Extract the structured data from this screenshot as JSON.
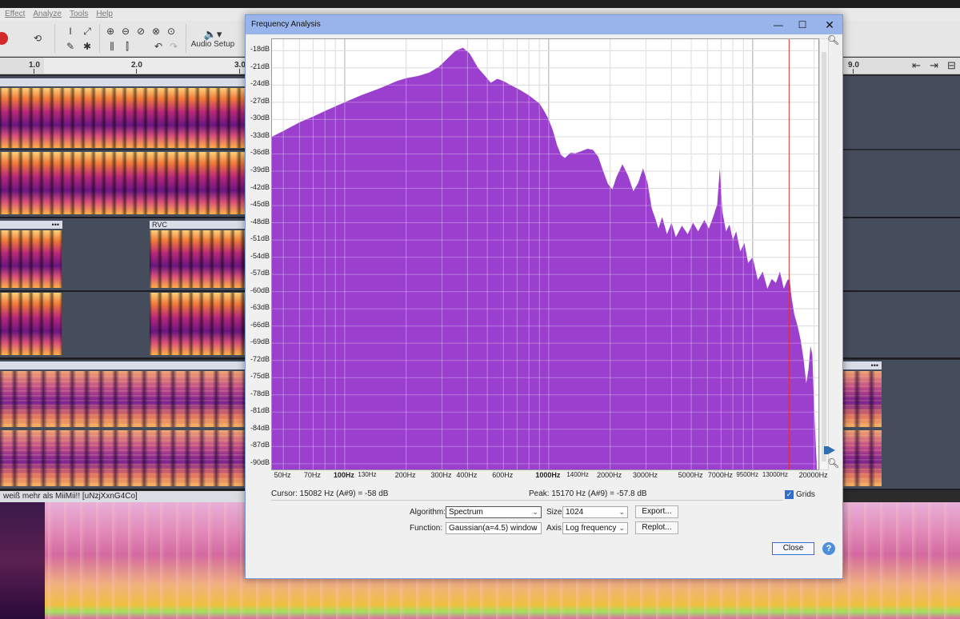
{
  "menu": [
    "Effect",
    "Analyze",
    "Tools",
    "Help"
  ],
  "toolbar": {
    "audio_setup_label": "Audio Setup"
  },
  "ruler": {
    "ticks": [
      "1.0",
      "2.0",
      "3.0",
      "9.0"
    ]
  },
  "clips": {
    "rvc_label": "RVC",
    "menu_dots": "•••",
    "track_name": "weiß mehr als MiiMii!! [uNzjXxnG4Co]"
  },
  "dialog": {
    "title": "Frequency Analysis",
    "cursor_text": "Cursor:  15082 Hz (A#9) = -58 dB",
    "peak_text": "Peak:  15170 Hz (A#9) = -57.8 dB",
    "grids_label": "Grids",
    "grids_checked": true,
    "algorithm_label": "Algorithm:",
    "algorithm_value": "Spectrum",
    "size_label": "Size:",
    "size_value": "1024",
    "function_label": "Function:",
    "function_value": "Gaussian(a=4.5) window",
    "axis_label": "Axis:",
    "axis_value": "Log frequency",
    "export_label": "Export...",
    "replot_label": "Replot...",
    "close_label": "Close",
    "help_label": "?"
  },
  "chart_data": {
    "type": "area",
    "x_scale": "log",
    "y_unit": "dB",
    "fill_color": "#9b3fcf",
    "cursor_line_color": "#e03030",
    "cursor_frequency_hz": 15082,
    "grid": true,
    "xlim": [
      44,
      21000
    ],
    "ylim": [
      -91,
      -16
    ],
    "y_ticks": [
      "-18dB",
      "-21dB",
      "-24dB",
      "-27dB",
      "-30dB",
      "-33dB",
      "-36dB",
      "-39dB",
      "-42dB",
      "-45dB",
      "-48dB",
      "-51dB",
      "-54dB",
      "-57dB",
      "-60dB",
      "-63dB",
      "-66dB",
      "-69dB",
      "-72dB",
      "-75dB",
      "-78dB",
      "-81dB",
      "-84dB",
      "-87dB",
      "-90dB"
    ],
    "x_ticks": [
      {
        "hz": 50,
        "label": "50Hz"
      },
      {
        "hz": 70,
        "label": "70Hz"
      },
      {
        "hz": 100,
        "label": "100Hz",
        "bold": true
      },
      {
        "hz": 130,
        "label": "130Hz",
        "small": true
      },
      {
        "hz": 200,
        "label": "200Hz"
      },
      {
        "hz": 300,
        "label": "300Hz"
      },
      {
        "hz": 400,
        "label": "400Hz"
      },
      {
        "hz": 600,
        "label": "600Hz"
      },
      {
        "hz": 1000,
        "label": "1000Hz",
        "bold": true
      },
      {
        "hz": 1400,
        "label": "1400Hz",
        "small": true
      },
      {
        "hz": 2000,
        "label": "2000Hz"
      },
      {
        "hz": 3000,
        "label": "3000Hz"
      },
      {
        "hz": 5000,
        "label": "5000Hz"
      },
      {
        "hz": 7000,
        "label": "7000Hz"
      },
      {
        "hz": 9500,
        "label": "9500Hz",
        "small": true
      },
      {
        "hz": 13000,
        "label": "13000Hz",
        "small": true
      },
      {
        "hz": 20000,
        "label": "20000Hz"
      }
    ],
    "spectrum": [
      [
        44,
        -33
      ],
      [
        50,
        -32
      ],
      [
        60,
        -30.5
      ],
      [
        70,
        -29.5
      ],
      [
        80,
        -28.5
      ],
      [
        100,
        -27
      ],
      [
        120,
        -25.8
      ],
      [
        150,
        -24.5
      ],
      [
        180,
        -23.3
      ],
      [
        200,
        -22.8
      ],
      [
        230,
        -22.4
      ],
      [
        260,
        -21.8
      ],
      [
        290,
        -20.8
      ],
      [
        320,
        -19.3
      ],
      [
        350,
        -18
      ],
      [
        380,
        -17.5
      ],
      [
        410,
        -18.5
      ],
      [
        450,
        -21
      ],
      [
        490,
        -22.5
      ],
      [
        520,
        -23.6
      ],
      [
        560,
        -22.9
      ],
      [
        600,
        -23.3
      ],
      [
        650,
        -24
      ],
      [
        720,
        -24.8
      ],
      [
        800,
        -25.8
      ],
      [
        900,
        -27.2
      ],
      [
        950,
        -28.5
      ],
      [
        1000,
        -30
      ],
      [
        1050,
        -32
      ],
      [
        1100,
        -34.5
      ],
      [
        1150,
        -36.2
      ],
      [
        1200,
        -36.7
      ],
      [
        1280,
        -35.8
      ],
      [
        1350,
        -35.9
      ],
      [
        1450,
        -35.5
      ],
      [
        1550,
        -35.1
      ],
      [
        1650,
        -35.3
      ],
      [
        1750,
        -36.5
      ],
      [
        1850,
        -39
      ],
      [
        1950,
        -41.2
      ],
      [
        2050,
        -42.2
      ],
      [
        2150,
        -40
      ],
      [
        2300,
        -37.8
      ],
      [
        2450,
        -39.8
      ],
      [
        2600,
        -42.5
      ],
      [
        2750,
        -41
      ],
      [
        2900,
        -38.5
      ],
      [
        3050,
        -41
      ],
      [
        3200,
        -45.5
      ],
      [
        3350,
        -47.5
      ],
      [
        3450,
        -49
      ],
      [
        3600,
        -47
      ],
      [
        3800,
        -50
      ],
      [
        4000,
        -48
      ],
      [
        4200,
        -50.5
      ],
      [
        4500,
        -48.5
      ],
      [
        4800,
        -50
      ],
      [
        5100,
        -48
      ],
      [
        5400,
        -49.5
      ],
      [
        5800,
        -47.5
      ],
      [
        6100,
        -49
      ],
      [
        6400,
        -47
      ],
      [
        6700,
        -44.8
      ],
      [
        6900,
        -38.5
      ],
      [
        7100,
        -46
      ],
      [
        7400,
        -49.5
      ],
      [
        7700,
        -48.3
      ],
      [
        8000,
        -51
      ],
      [
        8300,
        -49.5
      ],
      [
        8700,
        -53
      ],
      [
        9100,
        -51.5
      ],
      [
        9500,
        -55
      ],
      [
        10000,
        -54
      ],
      [
        10600,
        -58
      ],
      [
        11200,
        -56.5
      ],
      [
        11800,
        -59.5
      ],
      [
        12400,
        -57.8
      ],
      [
        13000,
        -58.5
      ],
      [
        13600,
        -56.5
      ],
      [
        14200,
        -59.5
      ],
      [
        14800,
        -58
      ],
      [
        15170,
        -57.8
      ],
      [
        15500,
        -61
      ],
      [
        16000,
        -64
      ],
      [
        16600,
        -66
      ],
      [
        17200,
        -68.5
      ],
      [
        17800,
        -72
      ],
      [
        18300,
        -76
      ],
      [
        18800,
        -73.5
      ],
      [
        19200,
        -69.5
      ],
      [
        19600,
        -71
      ],
      [
        20000,
        -80
      ],
      [
        20300,
        -85
      ],
      [
        20600,
        -90
      ]
    ]
  }
}
